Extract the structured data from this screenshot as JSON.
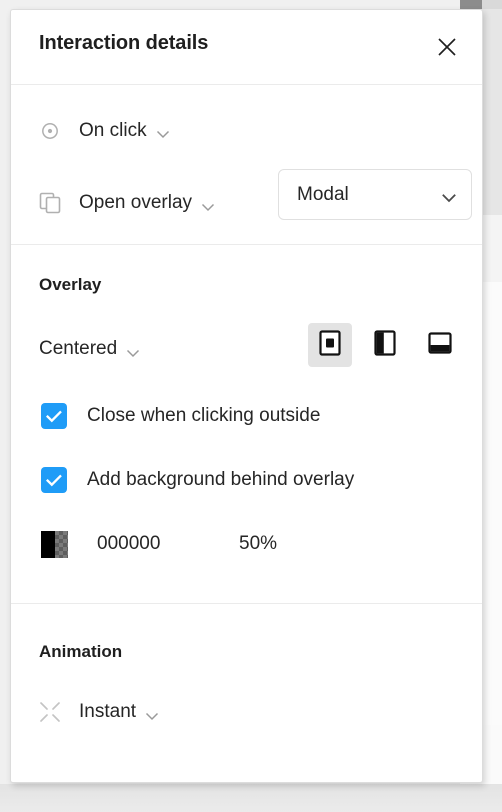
{
  "panel": {
    "title": "Interaction details",
    "close_icon": "close-icon"
  },
  "trigger": {
    "icon": "click-target-icon",
    "label": "On click",
    "chevron_icon": "chevron-down-icon"
  },
  "action": {
    "icon": "overlay-icon",
    "label": "Open overlay",
    "chevron_icon": "chevron-down-icon",
    "overlay_type": "Modal",
    "overlay_type_chevron_icon": "chevron-down-icon"
  },
  "overlay_section": {
    "heading": "Overlay",
    "position_label": "Centered",
    "position_chevron_icon": "chevron-down-icon",
    "position_buttons": [
      {
        "name": "position-centered",
        "icon": "overlay-centered-icon",
        "selected": true
      },
      {
        "name": "position-left",
        "icon": "overlay-left-panel-icon",
        "selected": false
      },
      {
        "name": "position-bottom",
        "icon": "overlay-bottom-sheet-icon",
        "selected": false
      }
    ],
    "checkboxes": [
      {
        "label": "Close when clicking outside",
        "checked": true
      },
      {
        "label": "Add background behind overlay",
        "checked": true
      }
    ],
    "background_color": {
      "swatch_icon": "color-swatch",
      "hex": "000000",
      "opacity": "50%"
    }
  },
  "animation_section": {
    "heading": "Animation",
    "icon": "collapse-arrows-icon",
    "label": "Instant",
    "chevron_icon": "chevron-down-icon"
  },
  "colors": {
    "accent_blue": "#1f9cf7",
    "text_primary": "#262626",
    "divider": "#ebebeb",
    "swatch_black": "#000000"
  }
}
